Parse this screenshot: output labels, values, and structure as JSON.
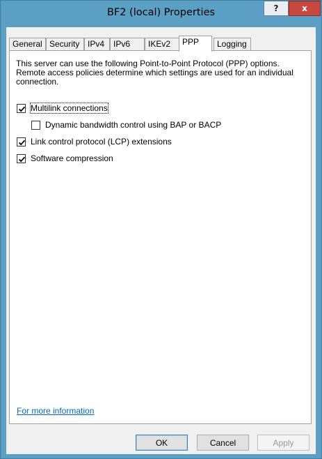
{
  "window": {
    "title": "BF2 (local) Properties",
    "help_label": "?",
    "close_label": "x"
  },
  "tabs": [
    {
      "label": "General",
      "active": false
    },
    {
      "label": "Security",
      "active": false
    },
    {
      "label": "IPv4",
      "active": false
    },
    {
      "label": "IPv6",
      "active": false
    },
    {
      "label": "IKEv2",
      "active": false
    },
    {
      "label": "PPP",
      "active": true
    },
    {
      "label": "Logging",
      "active": false
    }
  ],
  "ppp": {
    "description": "This server can use the following Point-to-Point Protocol (PPP) options. Remote access policies determine which settings are used for an individual connection.",
    "options": [
      {
        "label": "Multilink connections",
        "checked": true
      },
      {
        "label": "Dynamic bandwidth control using BAP or BACP",
        "checked": false
      },
      {
        "label": "Link control protocol (LCP) extensions",
        "checked": true
      },
      {
        "label": "Software compression",
        "checked": true
      }
    ],
    "more_info_link": "For more information"
  },
  "buttons": {
    "ok": "OK",
    "cancel": "Cancel",
    "apply": "Apply"
  }
}
